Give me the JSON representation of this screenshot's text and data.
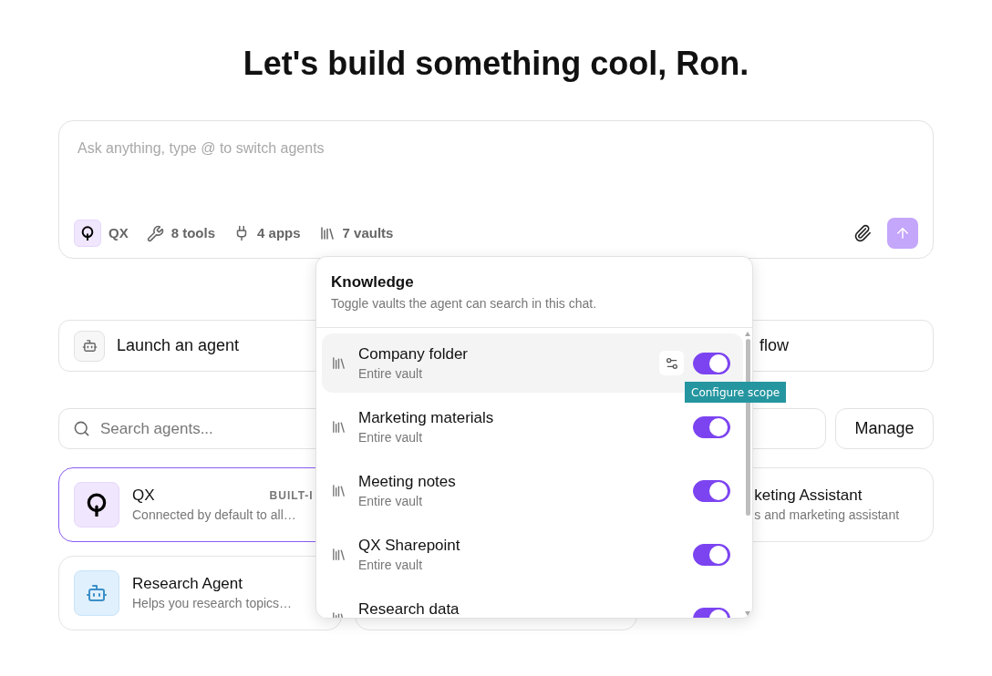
{
  "heading": "Let's build something cool, Ron.",
  "composer": {
    "placeholder": "Ask anything, type @ to switch agents",
    "chips": [
      {
        "kind": "agent",
        "label": "QX"
      },
      {
        "kind": "tools",
        "label": "8 tools"
      },
      {
        "kind": "apps",
        "label": "4 apps"
      },
      {
        "kind": "vaults",
        "label": "7 vaults"
      }
    ]
  },
  "quick_actions": [
    {
      "kind": "agent",
      "label": "Launch an agent"
    },
    {
      "kind": "covered",
      "label": "flow"
    }
  ],
  "search": {
    "placeholder": "Search agents..."
  },
  "manage_button": "Manage",
  "agents": [
    {
      "kind": "qx",
      "name": "QX",
      "badge": "BUILT-I",
      "description": "Connected by default to all…",
      "selected": true
    },
    {
      "kind": "covered-icon",
      "name": "keting Assistant",
      "description": "s and marketing assistant",
      "selected": false
    },
    {
      "kind": "bot",
      "name": "Research Agent",
      "description": "Helps you research topics…",
      "selected": false
    },
    {
      "kind": "covered"
    }
  ],
  "knowledge": {
    "title": "Knowledge",
    "subtitle": "Toggle vaults the agent can search in this chat.",
    "tooltip": "Configure scope",
    "vaults": [
      {
        "name": "Company folder",
        "scope": "Entire vault",
        "on": true,
        "hovered": true
      },
      {
        "name": "Marketing materials",
        "scope": "Entire vault",
        "on": true,
        "hovered": false
      },
      {
        "name": "Meeting notes",
        "scope": "Entire vault",
        "on": true,
        "hovered": false
      },
      {
        "name": "QX Sharepoint",
        "scope": "Entire vault",
        "on": true,
        "hovered": false
      },
      {
        "name": "Research data",
        "on": true,
        "hovered": false
      }
    ]
  }
}
